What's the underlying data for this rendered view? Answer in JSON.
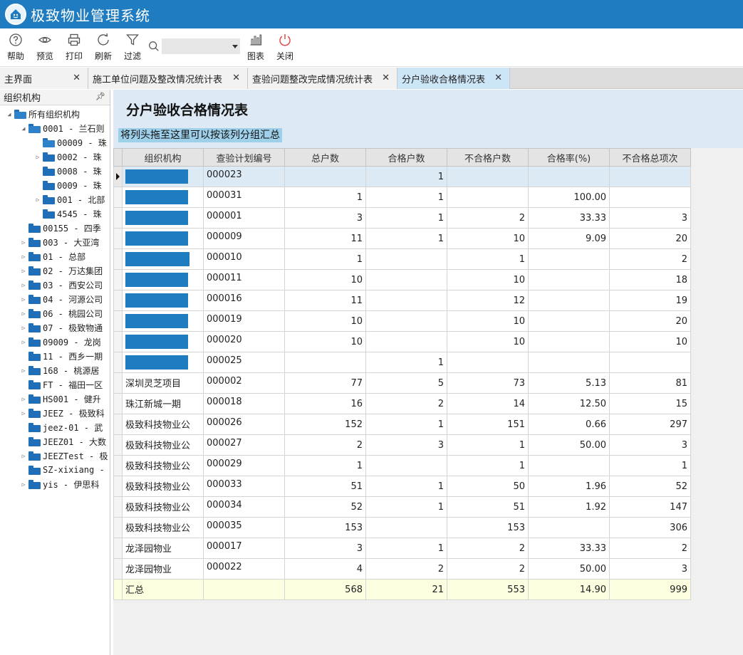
{
  "app": {
    "title": "极致物业管理系统"
  },
  "toolbar": {
    "help": "帮助",
    "preview": "预览",
    "print": "打印",
    "refresh": "刷新",
    "filter": "过滤",
    "chart": "图表",
    "close": "关闭",
    "search_value": ""
  },
  "tabs": [
    {
      "label": "主界面"
    },
    {
      "label": "施工单位问题及整改情况统计表"
    },
    {
      "label": "查验问题整改完成情况统计表"
    },
    {
      "label": "分户验收合格情况表"
    }
  ],
  "sidebar": {
    "title": "组织机构",
    "nodes": [
      "所有组织机构",
      "0001 - 兰石则",
      "00009 - 珠",
      "0002 - 珠",
      "0008 - 珠",
      "0009 - 珠",
      "001 - 北部",
      "4545 - 珠",
      "00155 - 四季",
      "003 - 大亚湾",
      "01 - 总部",
      "02 - 万达集团",
      "03 - 西安公司",
      "04 - 河源公司",
      "06 - 桃园公司",
      "07 - 极致物通",
      "09009 - 龙岗",
      "11 - 西乡一期",
      "168 - 桃源居",
      "FT - 福田一区",
      "HS001 - 健升",
      "JEEZ - 极致科",
      "jeez-01 - 武",
      "JEEZ01 - 大数",
      "JEEZTest - 极",
      "SZ-xixiang -",
      "yis - 伊思科"
    ]
  },
  "report": {
    "title": "分户验收合格情况表",
    "group_hint": "将列头拖至这里可以按该列分组汇总",
    "columns": [
      "组织机构",
      "查验计划编号",
      "总户数",
      "合格户数",
      "不合格户数",
      "合格率(%)",
      "不合格总项次"
    ],
    "rows": [
      [
        "",
        "000023",
        "",
        "1",
        "",
        "",
        ""
      ],
      [
        "",
        "000031",
        "1",
        "1",
        "",
        "100.00",
        ""
      ],
      [
        "",
        "000001",
        "3",
        "1",
        "2",
        "33.33",
        "3"
      ],
      [
        "",
        "000009",
        "11",
        "1",
        "10",
        "9.09",
        "20"
      ],
      [
        "",
        "000010",
        "1",
        "",
        "1",
        "",
        "2"
      ],
      [
        "",
        "000011",
        "10",
        "",
        "10",
        "",
        "18"
      ],
      [
        "",
        "000016",
        "11",
        "",
        "12",
        "",
        "19"
      ],
      [
        "",
        "000019",
        "10",
        "",
        "10",
        "",
        "20"
      ],
      [
        "",
        "000020",
        "10",
        "",
        "10",
        "",
        "10"
      ],
      [
        "",
        "000025",
        "",
        "1",
        "",
        "",
        ""
      ],
      [
        "深圳灵芝项目",
        "000002",
        "77",
        "5",
        "73",
        "5.13",
        "81"
      ],
      [
        "珠江新城一期",
        "000018",
        "16",
        "2",
        "14",
        "12.50",
        "15"
      ],
      [
        "极致科技物业公",
        "000026",
        "152",
        "1",
        "151",
        "0.66",
        "297"
      ],
      [
        "极致科技物业公",
        "000027",
        "2",
        "3",
        "1",
        "50.00",
        "3"
      ],
      [
        "极致科技物业公",
        "000029",
        "1",
        "",
        "1",
        "",
        "1"
      ],
      [
        "极致科技物业公",
        "000033",
        "51",
        "1",
        "50",
        "1.96",
        "52"
      ],
      [
        "极致科技物业公",
        "000034",
        "52",
        "1",
        "51",
        "1.92",
        "147"
      ],
      [
        "极致科技物业公",
        "000035",
        "153",
        "",
        "153",
        "",
        "306"
      ],
      [
        "龙泽园物业",
        "000017",
        "3",
        "1",
        "2",
        "33.33",
        "2"
      ],
      [
        "龙泽园物业",
        "000022",
        "4",
        "2",
        "2",
        "50.00",
        "3"
      ]
    ],
    "total": [
      "汇总",
      "",
      "568",
      "21",
      "553",
      "14.90",
      "999"
    ]
  },
  "colors": {
    "titlebar": "#1f7cc0",
    "accent": "#1e6fb8",
    "tab_active": "#cde6f7"
  }
}
